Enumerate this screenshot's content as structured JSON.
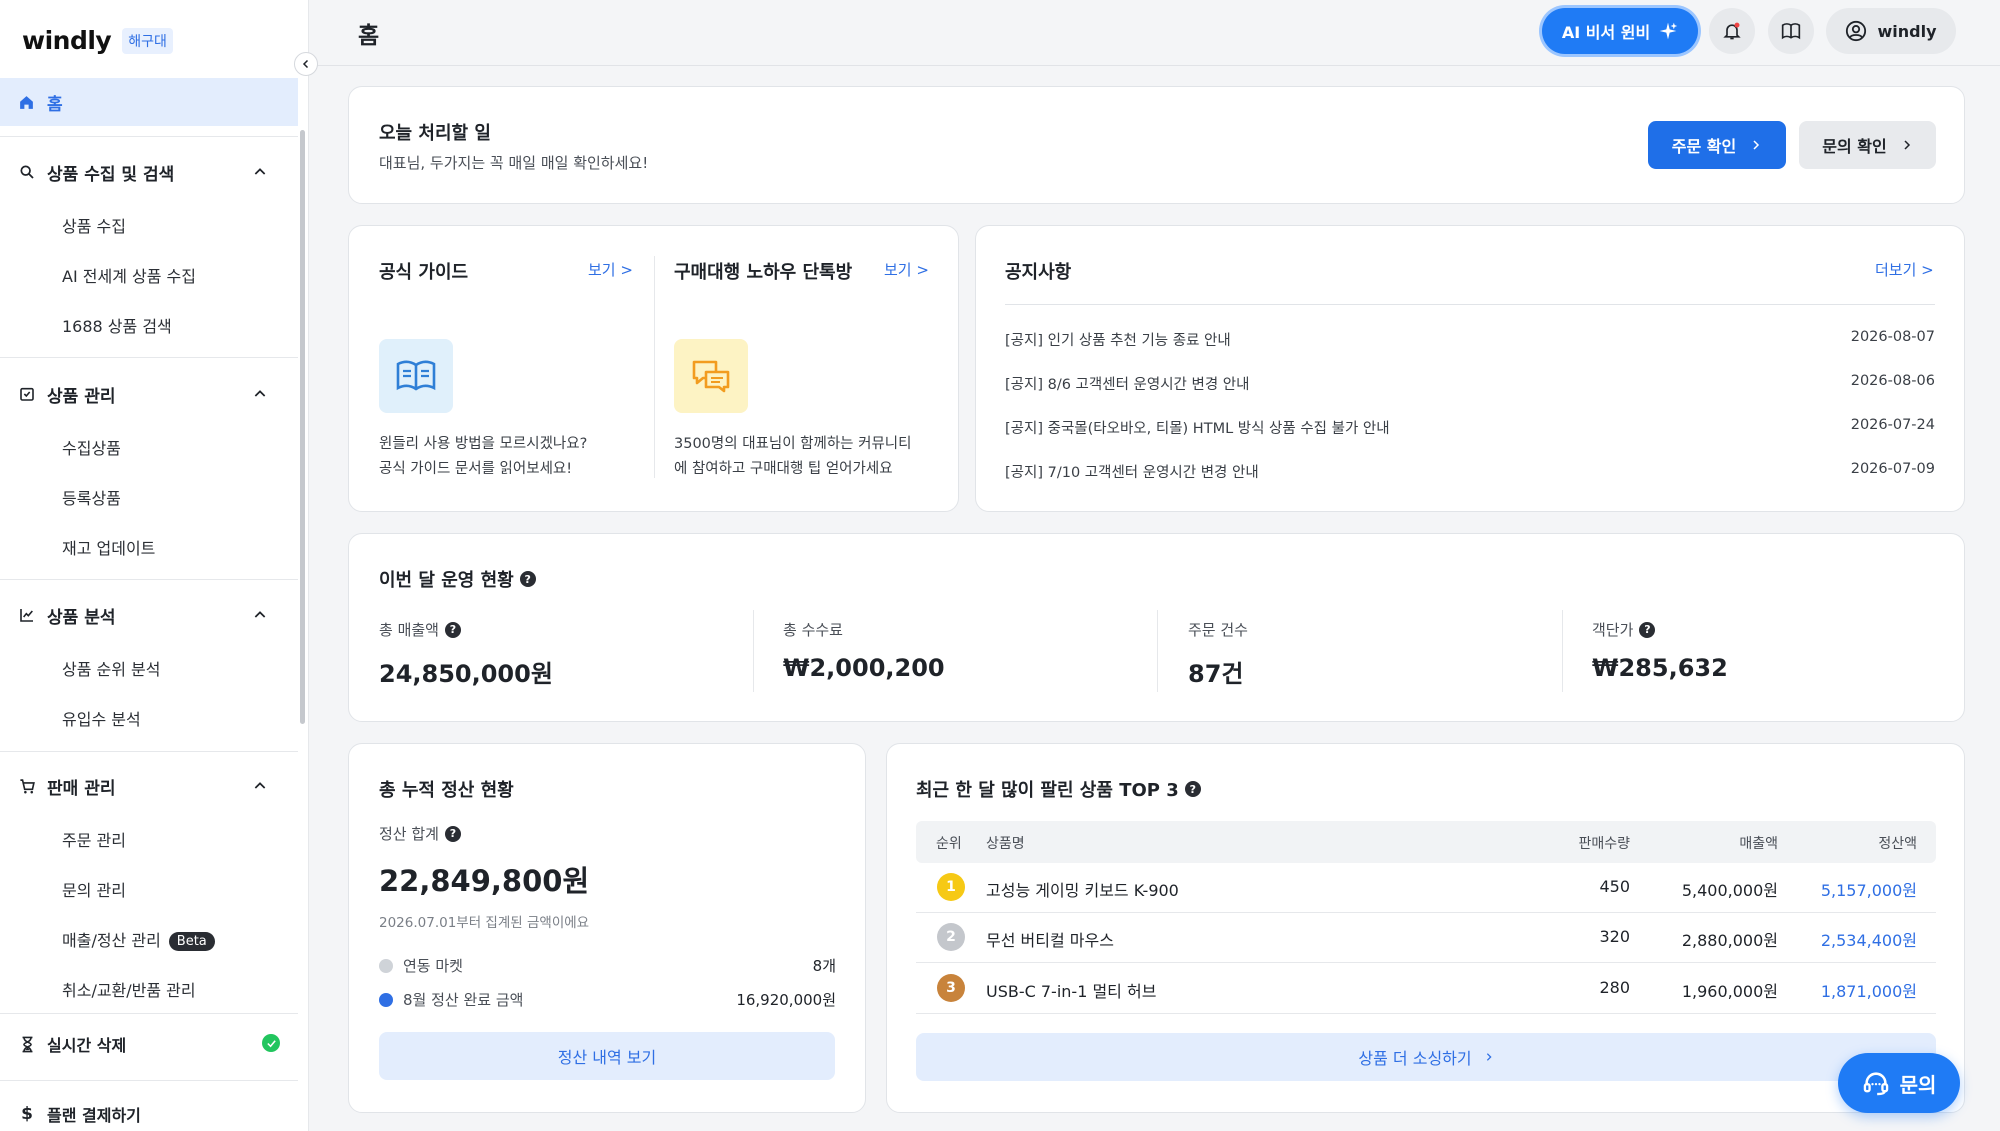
{
  "sidebar": {
    "logo": "windly",
    "branch": "해구대",
    "home": "홈",
    "sections": [
      {
        "label": "상품 수집 및 검색",
        "items": [
          "상품 수집",
          "AI 전세계 상품 수집",
          "1688 상품 검색"
        ]
      },
      {
        "label": "상품 관리",
        "items": [
          "수집상품",
          "등록상품",
          "재고 업데이트"
        ]
      },
      {
        "label": "상품 분석",
        "items": [
          "상품 순위 분석",
          "유입수 분석"
        ]
      },
      {
        "label": "판매 관리",
        "items": [
          "주문 관리",
          "문의 관리",
          "매출/정산 관리",
          "취소/교환/반품 관리"
        ],
        "badge": "Beta"
      }
    ],
    "realtime": "실시간 삭제",
    "plan": "플랜 결제하기"
  },
  "topbar": {
    "title": "홈",
    "ai_button": "AI 비서 윈비",
    "user": "windly"
  },
  "todo": {
    "title": "오늘 처리할 일",
    "subtitle": "대표님, 두가지는 꼭 매일 매일 확인하세요!",
    "order_button": "주문 확인",
    "inquiry_button": "문의 확인"
  },
  "guide": {
    "title": "공식 가이드",
    "link": "보기 >",
    "desc1": "윈들리 사용 방법을 모르시겠나요?",
    "desc2": "공식 가이드 문서를 읽어보세요!"
  },
  "community": {
    "title": "구매대행 노하우 단톡방",
    "link": "보기 >",
    "desc1": "3500명의 대표님이 함께하는 커뮤니티",
    "desc2": "에 참여하고 구매대행 팁 얻어가세요"
  },
  "notices": {
    "title": "공지사항",
    "more": "더보기 >",
    "items": [
      {
        "text": "[공지] 인기 상품 추천 기능 종료 안내",
        "date": "2026-08-07"
      },
      {
        "text": "[공지] 8/6 고객센터 운영시간 변경 안내",
        "date": "2026-08-06"
      },
      {
        "text": "[공지] 중국몰(타오바오, 티몰) HTML 방식 상품 수집 불가 안내",
        "date": "2026-07-24"
      },
      {
        "text": "[공지] 7/10 고객센터 운영시간 변경 안내",
        "date": "2026-07-09"
      }
    ]
  },
  "monthly": {
    "title": "이번 달 운영 현황",
    "stats": [
      {
        "label": "총 매출액",
        "value": "24,850,000원"
      },
      {
        "label": "총 수수료",
        "value": "₩2,000,200"
      },
      {
        "label": "주문 건수",
        "value": "87건"
      },
      {
        "label": "객단가",
        "value": "₩285,632"
      }
    ]
  },
  "settlement": {
    "title": "총 누적 정산 현황",
    "sum_label": "정산 합계",
    "sum_value": "22,849,800원",
    "note": "2026.07.01부터 집계된 금액이에요",
    "market_label": "연동 마켓",
    "market_value": "8개",
    "done_label": "8월 정산 완료 금액",
    "done_value": "16,920,000원",
    "button": "정산 내역 보기",
    "colors": {
      "market": "#cfd3d8",
      "done": "#2f6fe4"
    }
  },
  "top3": {
    "title": "최근 한 달 많이 팔린 상품 TOP 3",
    "headers": {
      "rank": "순위",
      "name": "상품명",
      "qty": "판매수량",
      "sales": "매출액",
      "settle": "정산액"
    },
    "rows": [
      {
        "rank": "1",
        "name": "고성능 게이밍 키보드 K-900",
        "qty": "450",
        "sales": "5,400,000원",
        "settle": "5,157,000원",
        "color": "#f6c915"
      },
      {
        "rank": "2",
        "name": "무선 버티컬 마우스",
        "qty": "320",
        "sales": "2,880,000원",
        "settle": "2,534,400원",
        "color": "#c4c7cc"
      },
      {
        "rank": "3",
        "name": "USB-C 7-in-1 멀티 허브",
        "qty": "280",
        "sales": "1,960,000원",
        "settle": "1,871,000원",
        "color": "#c8833b"
      }
    ],
    "button": "상품 더 소싱하기"
  },
  "inquiry_fab": "문의"
}
